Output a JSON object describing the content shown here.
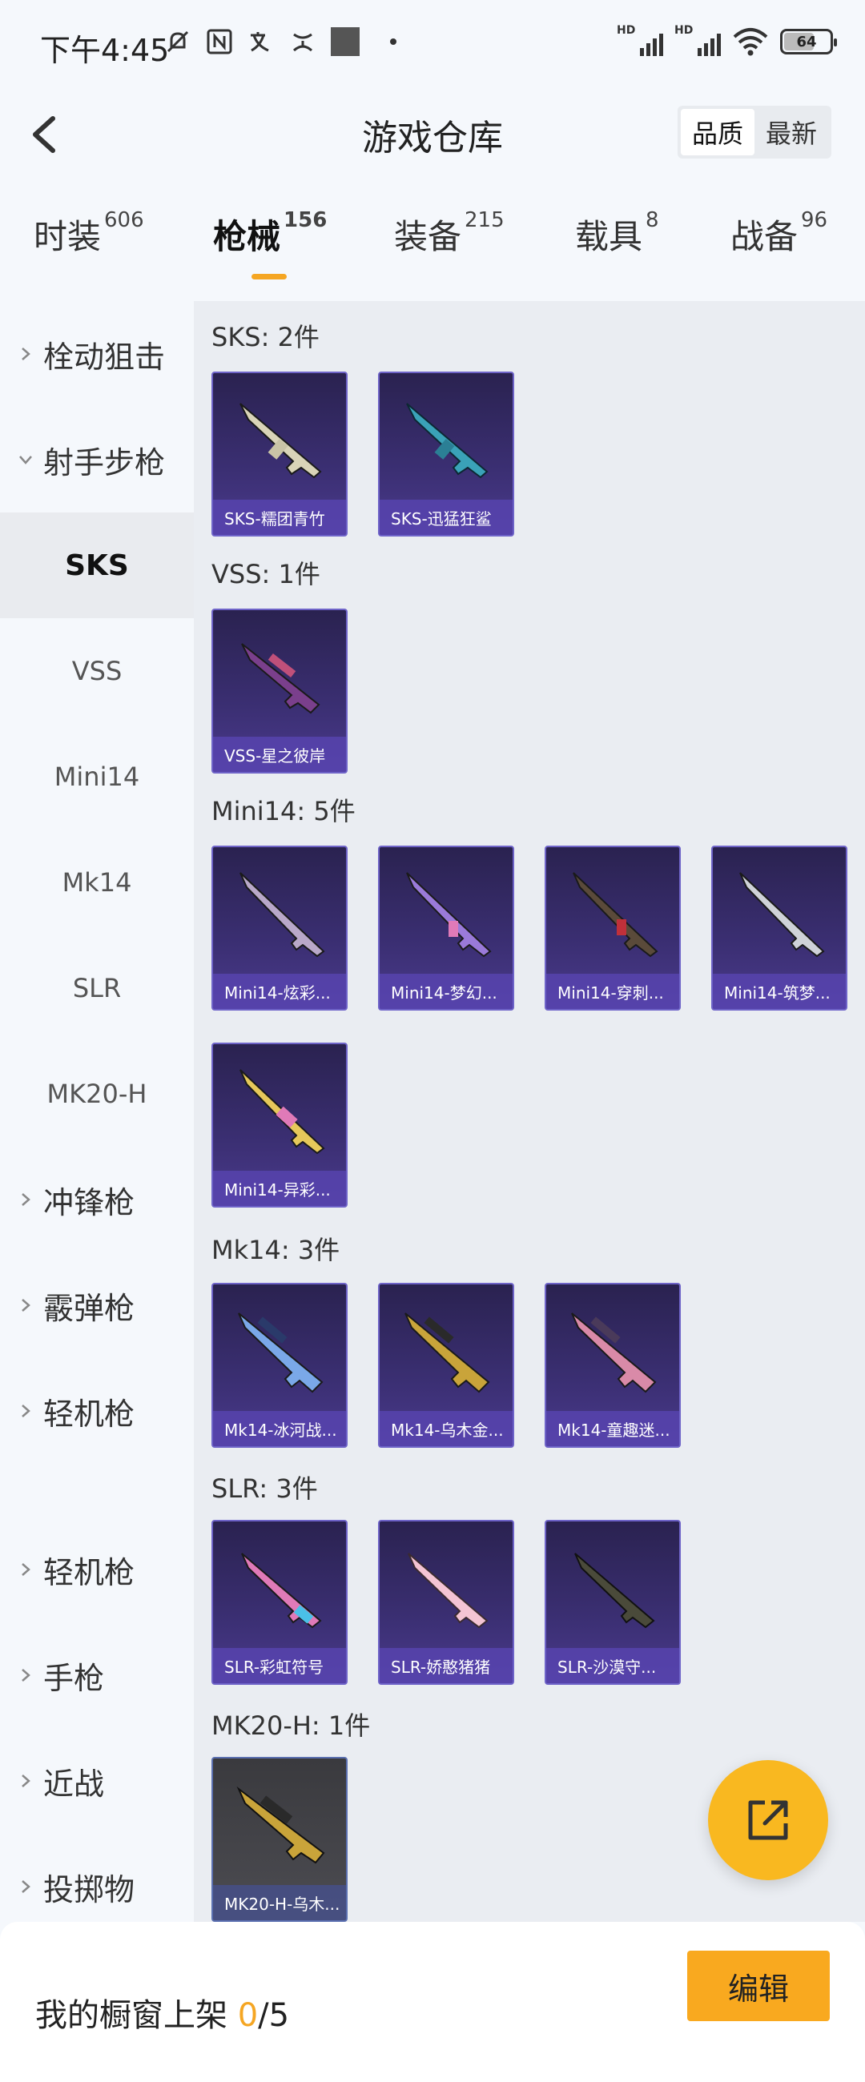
{
  "status_bar": {
    "time": "下午4:45",
    "battery": "64",
    "icons": [
      "mute-bell-icon",
      "nfc-icon",
      "translate-icon",
      "sleep-icon",
      "square-icon",
      "dot-icon",
      "hd-signal-icon",
      "hd-signal-icon",
      "wifi-icon",
      "battery-icon"
    ]
  },
  "header": {
    "title": "游戏仓库",
    "sort_quality": "品质",
    "sort_latest": "最新"
  },
  "tabs": [
    {
      "label": "时装",
      "count": "606"
    },
    {
      "label": "枪械",
      "count": "156",
      "active": true
    },
    {
      "label": "装备",
      "count": "215"
    },
    {
      "label": "载具",
      "count": "8"
    },
    {
      "label": "战备",
      "count": "96"
    }
  ],
  "categories": [
    {
      "label": "栓动狙击",
      "type": "group",
      "expanded": false
    },
    {
      "label": "射手步枪",
      "type": "group",
      "expanded": true
    },
    {
      "label": "SKS",
      "type": "sub",
      "active": true
    },
    {
      "label": "VSS",
      "type": "sub"
    },
    {
      "label": "Mini14",
      "type": "sub"
    },
    {
      "label": "Mk14",
      "type": "sub"
    },
    {
      "label": "SLR",
      "type": "sub"
    },
    {
      "label": "MK20-H",
      "type": "sub"
    },
    {
      "label": "冲锋枪",
      "type": "group"
    },
    {
      "label": "霰弹枪",
      "type": "group"
    },
    {
      "label": "轻机枪",
      "type": "group"
    },
    {
      "label": "轻机枪",
      "type": "group"
    },
    {
      "label": "手枪",
      "type": "group"
    },
    {
      "label": "近战",
      "type": "group"
    },
    {
      "label": "投掷物",
      "type": "group"
    }
  ],
  "sections": [
    {
      "title": "SKS: 2件",
      "items": [
        "SKS-糯团青竹",
        "SKS-迅猛狂鲨"
      ]
    },
    {
      "title": "VSS: 1件",
      "items": [
        "VSS-星之彼岸"
      ]
    },
    {
      "title": "Mini14: 5件",
      "items": [
        "Mini14-炫彩...",
        "Mini14-梦幻...",
        "Mini14-穿刺...",
        "Mini14-筑梦...",
        "Mini14-异彩..."
      ]
    },
    {
      "title": "Mk14: 3件",
      "items": [
        "Mk14-冰河战...",
        "Mk14-乌木金...",
        "Mk14-童趣迷..."
      ]
    },
    {
      "title": "SLR: 3件",
      "items": [
        "SLR-彩虹符号",
        "SLR-娇憨猪猪",
        "SLR-沙漠守..."
      ]
    },
    {
      "title": "MK20-H: 1件",
      "items": [
        "MK20-H-乌木..."
      ]
    }
  ],
  "footer": {
    "shelf_label": "我的橱窗上架 ",
    "shelf_current": "0",
    "shelf_total": "/5",
    "edit_label": "编辑"
  },
  "colors": {
    "accent": "#f9a91f",
    "tab_indicator": "#f5a623",
    "card_purple": "#3b2f73"
  }
}
